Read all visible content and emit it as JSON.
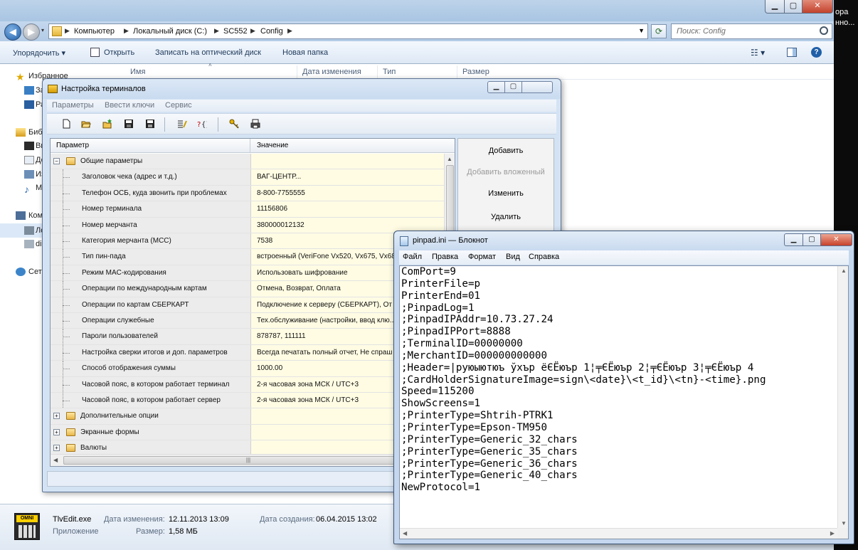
{
  "desktop": {
    "strip_text_1": "ора",
    "strip_text_2": "нно..."
  },
  "explorer": {
    "address": {
      "crumbs": [
        "Компьютер",
        "Локальный диск (C:)",
        "SC552",
        "Config"
      ]
    },
    "search": {
      "placeholder": "Поиск: Config"
    },
    "toolbar": {
      "organize": "Упорядочить ▾",
      "open": "Открыть",
      "burn": "Записать на оптический диск",
      "new_folder": "Новая папка"
    },
    "nav": {
      "favorites": "Избранное",
      "fav_1": "За",
      "fav_2": "Ра",
      "libraries": "Биб",
      "lib_1": "Ви",
      "lib_2": "До",
      "lib_3": "Из",
      "lib_4": "М",
      "computer": "Комп",
      "local_disk": "Ло",
      "drive_2": "di",
      "network": "Сет"
    },
    "columns": {
      "name": "Имя",
      "date": "Дата изменения",
      "type": "Тип",
      "size": "Размер"
    },
    "details": {
      "icon_label": "OMNI",
      "filename": "TlvEdit.exe",
      "type": "Приложение",
      "modified_label": "Дата изменения:",
      "modified": "12.11.2013 13:09",
      "size_label": "Размер:",
      "size": "1,58 МБ",
      "created_label": "Дата создания:",
      "created": "06.04.2015 13:02"
    }
  },
  "terminal_window": {
    "title": "Настройка терминалов",
    "menu": [
      "Параметры",
      "Ввести ключи",
      "Сервис"
    ],
    "grid": {
      "col_param": "Параметр",
      "col_value": "Значение",
      "rows": [
        {
          "kind": "group",
          "expanded": true,
          "label": "Общие параметры",
          "value": ""
        },
        {
          "kind": "item",
          "label": "Заголовок чека (адрес и т.д.)",
          "value": "ВАГ-ЦЕНТР..."
        },
        {
          "kind": "item",
          "label": "Телефон ОСБ, куда звонить при проблемах",
          "value": "8-800-7755555"
        },
        {
          "kind": "item",
          "label": "Номер терминала",
          "value": "11156806"
        },
        {
          "kind": "item",
          "label": "Номер мерчанта",
          "value": "380000012132"
        },
        {
          "kind": "item",
          "label": "Категория мерчанта (МСС)",
          "value": "7538"
        },
        {
          "kind": "item",
          "label": "Тип пин-пада",
          "value": "встроенный (VeriFone Vx520, Vx675, Vx68"
        },
        {
          "kind": "item",
          "label": "Режим MAC-кодирования",
          "value": "Использовать шифрование"
        },
        {
          "kind": "item",
          "label": "Операции по международным картам",
          "value": "Отмена, Возврат, Оплата"
        },
        {
          "kind": "item",
          "label": "Операции по картам СБЕРКАРТ",
          "value": "Подключение к серверу (СБЕРКАРТ), От"
        },
        {
          "kind": "item",
          "label": "Операции служебные",
          "value": "Тех.обслуживание (настройки, ввод клю..."
        },
        {
          "kind": "item",
          "label": "Пароли пользователей",
          "value": "878787, 111111"
        },
        {
          "kind": "item",
          "label": "Настройка сверки итогов и доп. параметров",
          "value": "Всегда печатать полный отчет, Не спраш"
        },
        {
          "kind": "item",
          "label": "Способ отображения суммы",
          "value": "1000.00"
        },
        {
          "kind": "item",
          "label": "Часовой пояс, в котором работает терминал",
          "value": "2-я часовая зона МСК / UTC+3"
        },
        {
          "kind": "item",
          "label": "Часовой пояс, в котором работает сервер",
          "value": "2-я часовая зона МСК / UTC+3"
        },
        {
          "kind": "group",
          "expanded": false,
          "label": "Дополнительные опции",
          "value": ""
        },
        {
          "kind": "group",
          "expanded": false,
          "label": "Экранные формы",
          "value": ""
        },
        {
          "kind": "group",
          "expanded": false,
          "label": "Валюты",
          "value": ""
        }
      ]
    },
    "buttons": {
      "add": "Добавить",
      "add_nested": "Добавить вложенный",
      "edit": "Изменить",
      "delete": "Удалить"
    },
    "toolbar_icons": [
      "new-file-icon",
      "open-folder-icon",
      "open-folder-star-icon",
      "save-icon",
      "save-all-icon",
      "edit-list-icon",
      "help-query-icon",
      "key-icon",
      "printer-icon"
    ]
  },
  "notepad": {
    "title": "pinpad.ini — Блокнот",
    "menu": [
      "Файл",
      "Правка",
      "Формат",
      "Вид",
      "Справка"
    ],
    "lines": [
      "ComPort=9",
      "PrinterFile=p",
      "PrinterEnd=01",
      ";PinpadLog=1",
      ";PinpadIPAddr=10.73.27.24",
      ";PinpadIPPort=8888",
      ";TerminalID=00000000",
      ";MerchantID=000000000000",
      ";Header=|руюыютюъ ўхър ёЄЁюър 1¦╤ЄЁюър 2¦╤ЄЁюър 3¦╤ЄЁюър 4",
      ";CardHolderSignatureImage=sign\\<date}\\<t_id}\\<tn}-<time}.png",
      "Speed=115200",
      "ShowScreens=1",
      ";PrinterType=Shtrih-PTRK1",
      ";PrinterType=Epson-TM950",
      ";PrinterType=Generic_32_chars",
      ";PrinterType=Generic_35_chars",
      ";PrinterType=Generic_36_chars",
      ";PrinterType=Generic_40_chars",
      "NewProtocol=1"
    ]
  }
}
